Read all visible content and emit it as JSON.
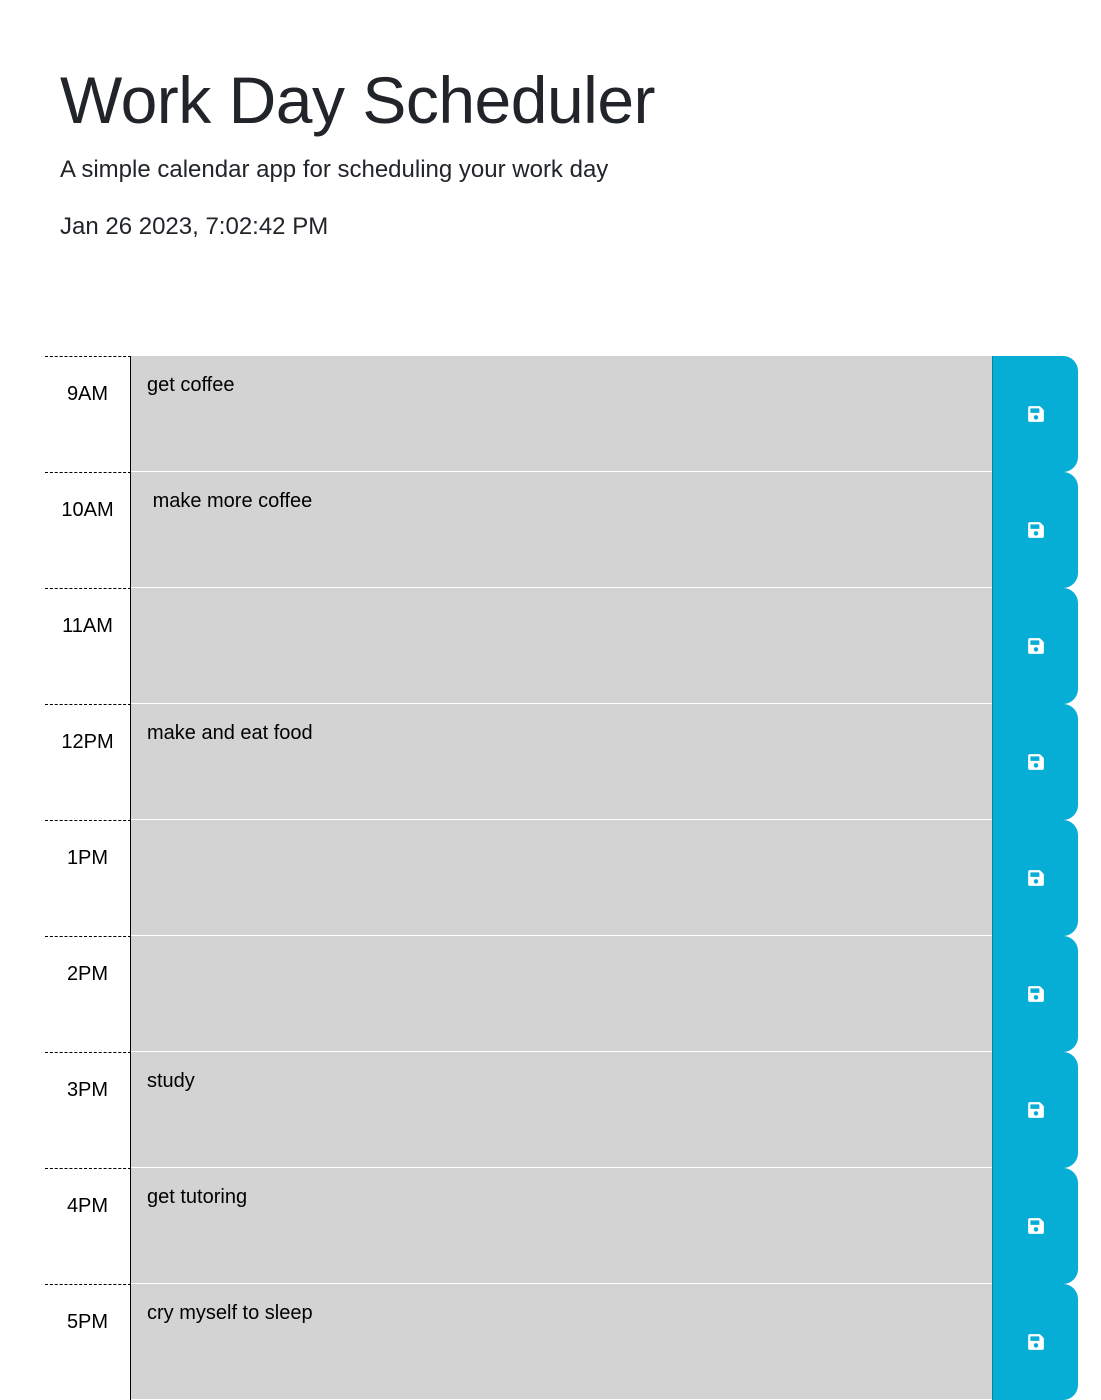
{
  "header": {
    "title": "Work Day Scheduler",
    "subtitle": "A simple calendar app for scheduling your work day",
    "current_datetime": "Jan 26 2023, 7:02:42 PM"
  },
  "colors": {
    "past": "#d3d3d3",
    "save_button": "#06aed5",
    "save_icon": "#ffffff"
  },
  "schedule": {
    "save_icon": "floppy-disk-icon",
    "rows": [
      {
        "hour": "9AM",
        "text": "get coffee"
      },
      {
        "hour": "10AM",
        "text": " make more coffee"
      },
      {
        "hour": "11AM",
        "text": ""
      },
      {
        "hour": "12PM",
        "text": "make and eat food"
      },
      {
        "hour": "1PM",
        "text": ""
      },
      {
        "hour": "2PM",
        "text": ""
      },
      {
        "hour": "3PM",
        "text": "study"
      },
      {
        "hour": "4PM",
        "text": "get tutoring"
      },
      {
        "hour": "5PM",
        "text": "cry myself to sleep"
      }
    ]
  }
}
